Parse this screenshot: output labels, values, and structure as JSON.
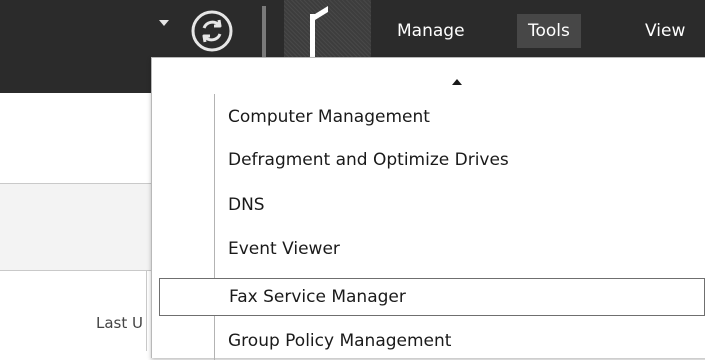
{
  "toolbar": {
    "icons": [
      "dropdown-arrow-icon",
      "refresh-icon",
      "flag-icon"
    ],
    "menus": [
      "Manage",
      "Tools",
      "View"
    ]
  },
  "table": {
    "column_header": "Last U"
  },
  "tools_menu": {
    "items": [
      "Computer Management",
      "Defragment and Optimize Drives",
      "DNS",
      "Event Viewer",
      "Fax Service Manager",
      "Group Policy Management"
    ],
    "highlighted_item": "Fax Service Manager"
  },
  "colors": {
    "toolbar_bg": "#2b2b2b",
    "menu_active_bg": "#474747",
    "menu_text": "#ffffff",
    "panel_bg": "#ffffff"
  }
}
